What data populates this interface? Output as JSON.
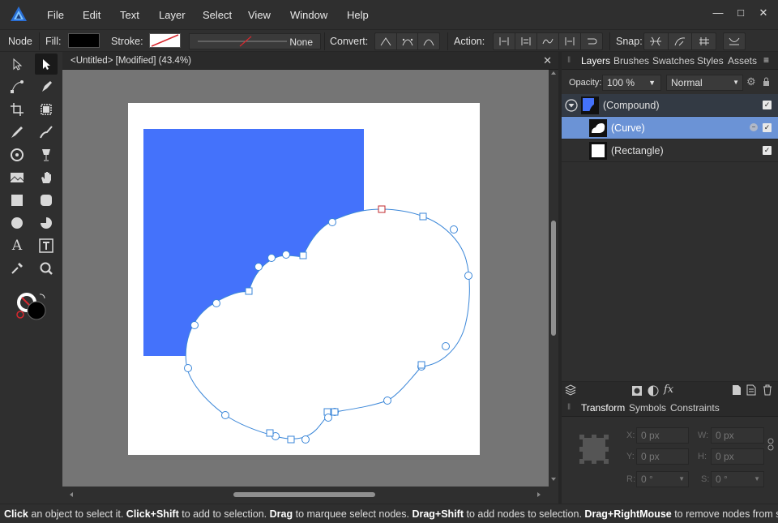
{
  "menu": [
    "File",
    "Edit",
    "Text",
    "Layer",
    "Select",
    "View",
    "Window",
    "Help"
  ],
  "window_controls": {
    "minimize": "—",
    "maximize": "□",
    "close": "✕"
  },
  "context": {
    "tool_name": "Node",
    "fill_label": "Fill:",
    "fill_color": "#000000",
    "stroke_label": "Stroke:",
    "stroke_value": "None",
    "convert_label": "Convert:",
    "action_label": "Action:",
    "snap_label": "Snap:"
  },
  "document": {
    "tab_title": "<Untitled> [Modified] (43.4%)",
    "close": "✕",
    "rect_color": "#4472fb",
    "curve_color": "#3a86d8",
    "selected_node_color": "#c0282e"
  },
  "panel": {
    "tabs": [
      "Layers",
      "Brushes",
      "Swatches",
      "Styles",
      "Assets"
    ],
    "opacity_label": "Opacity:",
    "opacity_value": "100 %",
    "blend_mode": "Normal",
    "layers": [
      {
        "name": "(Compound)",
        "checked": true
      },
      {
        "name": "(Curve)",
        "checked": true,
        "selected": true
      },
      {
        "name": "(Rectangle)",
        "checked": true
      }
    ],
    "bottom_tabs": [
      "Transform",
      "Symbols",
      "Constraints"
    ],
    "transform": {
      "x_label": "X:",
      "x_value": "0 px",
      "y_label": "Y:",
      "y_value": "0 px",
      "w_label": "W:",
      "w_value": "0 px",
      "h_label": "H:",
      "h_value": "0 px",
      "r_label": "R:",
      "r_value": "0 °",
      "s_label": "S:",
      "s_value": "0 °"
    }
  },
  "status": {
    "parts": [
      {
        "bold": "Click",
        "text": " an object to select it. "
      },
      {
        "bold": "Click+Shift",
        "text": " to add to selection. "
      },
      {
        "bold": "Drag",
        "text": " to marquee select nodes. "
      },
      {
        "bold": "Drag+Shift",
        "text": " to add nodes to selection. "
      },
      {
        "bold": "Drag+RightMouse",
        "text": " to remove nodes from selection"
      }
    ]
  }
}
